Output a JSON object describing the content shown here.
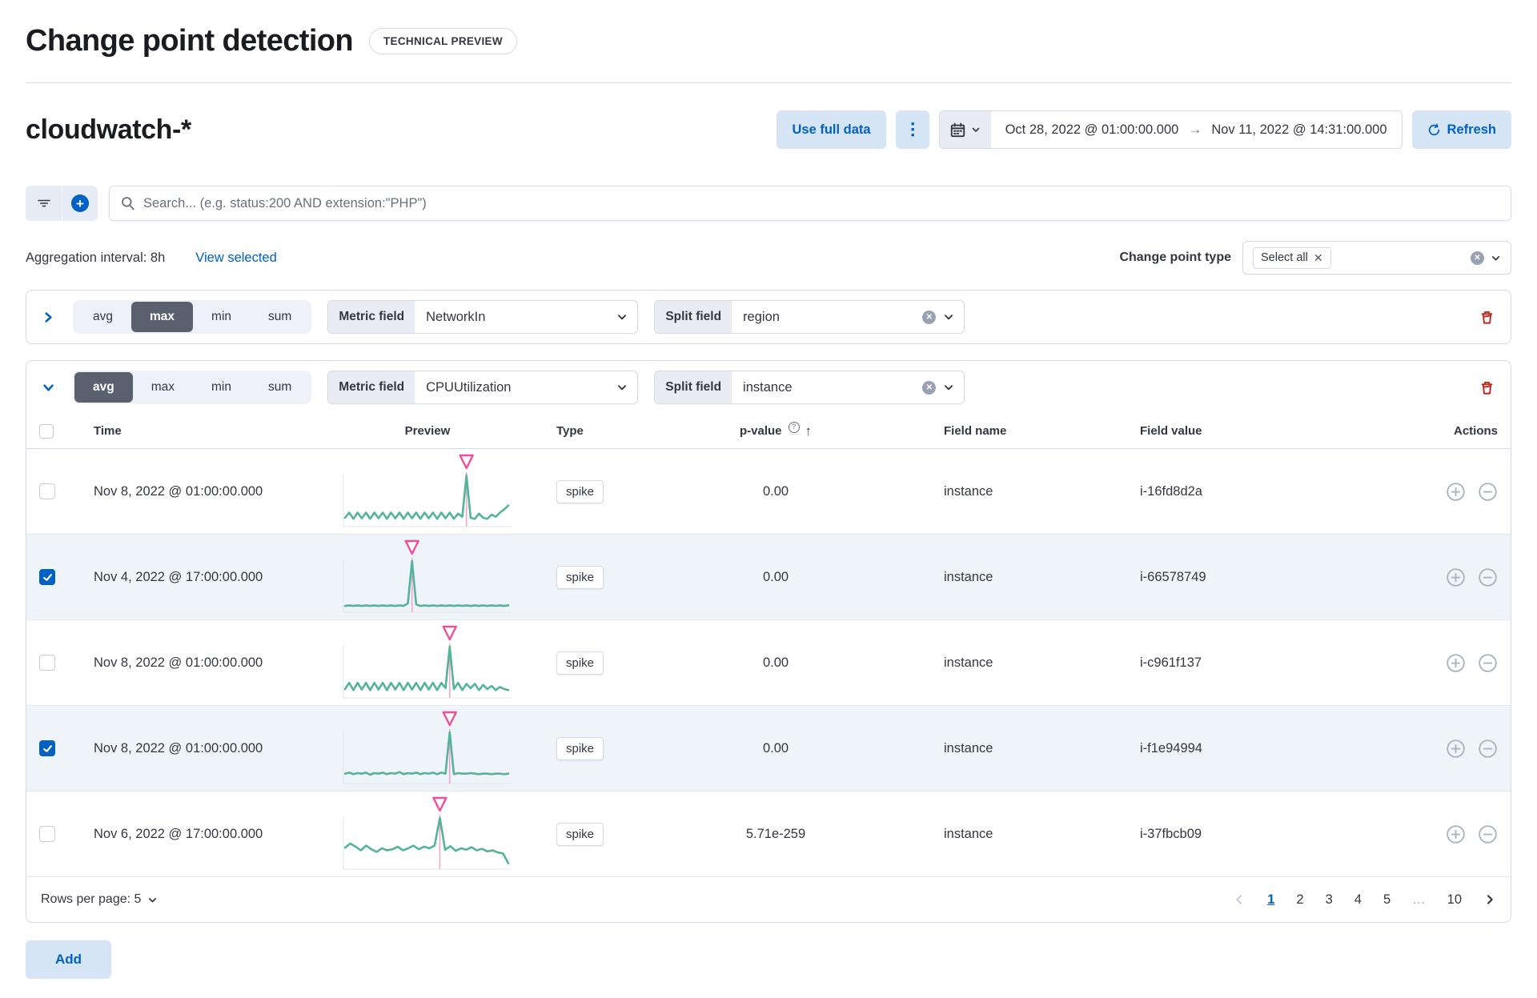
{
  "page": {
    "title": "Change point detection",
    "badge": "TECHNICAL PREVIEW"
  },
  "toolbar": {
    "index_pattern": "cloudwatch-*",
    "use_full_data": "Use full data",
    "date_start": "Oct 28, 2022 @ 01:00:00.000",
    "date_end": "Nov 11, 2022 @ 14:31:00.000",
    "date_arrow": "→",
    "refresh": "Refresh"
  },
  "search": {
    "placeholder": "Search... (e.g. status:200 AND extension:\"PHP\")"
  },
  "meta": {
    "aggregation_interval": "Aggregation interval: 8h",
    "view_selected": "View selected",
    "change_point_type_label": "Change point type",
    "change_point_type_value": "Select all",
    "pill_remove": "✕"
  },
  "configs": [
    {
      "agg_options": [
        "avg",
        "max",
        "min",
        "sum"
      ],
      "selected_agg": "max",
      "metric_label": "Metric field",
      "metric_value": "NetworkIn",
      "split_label": "Split field",
      "split_value": "region",
      "expanded": false
    },
    {
      "agg_options": [
        "avg",
        "max",
        "min",
        "sum"
      ],
      "selected_agg": "avg",
      "metric_label": "Metric field",
      "metric_value": "CPUUtilization",
      "split_label": "Split field",
      "split_value": "instance",
      "expanded": true
    }
  ],
  "table": {
    "columns": {
      "time": "Time",
      "preview": "Preview",
      "type": "Type",
      "p_value": "p-value",
      "field_name": "Field name",
      "field_value": "Field value",
      "actions": "Actions"
    },
    "p_value_info": "?",
    "sort_arrow": "↑",
    "rows": [
      {
        "checked": false,
        "time": "Nov 8, 2022 @ 01:00:00.000",
        "type": "spike",
        "p_value": "0.00",
        "field_name": "instance",
        "field_value": "i-16fd8d2a"
      },
      {
        "checked": true,
        "time": "Nov 4, 2022 @ 17:00:00.000",
        "type": "spike",
        "p_value": "0.00",
        "field_name": "instance",
        "field_value": "i-66578749"
      },
      {
        "checked": false,
        "time": "Nov 8, 2022 @ 01:00:00.000",
        "type": "spike",
        "p_value": "0.00",
        "field_name": "instance",
        "field_value": "i-c961f137"
      },
      {
        "checked": true,
        "time": "Nov 8, 2022 @ 01:00:00.000",
        "type": "spike",
        "p_value": "0.00",
        "field_name": "instance",
        "field_value": "i-f1e94994"
      },
      {
        "checked": false,
        "time": "Nov 6, 2022 @ 17:00:00.000",
        "type": "spike",
        "p_value": "5.71e-259",
        "field_name": "instance",
        "field_value": "i-37fbcb09"
      }
    ]
  },
  "chart_data": [
    {
      "type": "line",
      "label": "preview-spike-i-16fd8d2a",
      "color": "#54b399",
      "marker_color": "#f04e98",
      "spike_line_color": "#f2a7c3",
      "spike_index": 29,
      "values": [
        14,
        24,
        12,
        24,
        13,
        24,
        12,
        24,
        13,
        24,
        12,
        24,
        13,
        24,
        12,
        24,
        13,
        24,
        12,
        24,
        13,
        24,
        12,
        24,
        13,
        24,
        12,
        22,
        16,
        96,
        14,
        12,
        22,
        14,
        12,
        20,
        16,
        24,
        30,
        38
      ]
    },
    {
      "type": "line",
      "label": "preview-spike-i-66578749",
      "color": "#54b399",
      "marker_color": "#f04e98",
      "spike_line_color": "#f2a7c3",
      "spike_index": 16,
      "values": [
        9,
        10,
        9,
        10,
        9,
        10,
        9,
        10,
        9,
        10,
        9,
        10,
        9,
        10,
        9,
        14,
        94,
        12,
        9,
        10,
        9,
        10,
        9,
        10,
        9,
        10,
        9,
        10,
        9,
        10,
        9,
        10,
        9,
        10,
        9,
        10,
        9,
        10,
        9,
        10
      ]
    },
    {
      "type": "line",
      "label": "preview-spike-i-c961f137",
      "color": "#54b399",
      "marker_color": "#f04e98",
      "spike_line_color": "#f2a7c3",
      "spike_index": 25,
      "values": [
        14,
        26,
        12,
        26,
        13,
        26,
        12,
        26,
        13,
        26,
        12,
        26,
        13,
        26,
        12,
        26,
        13,
        26,
        12,
        26,
        13,
        26,
        12,
        26,
        16,
        96,
        14,
        26,
        12,
        24,
        16,
        24,
        12,
        22,
        14,
        20,
        12,
        18,
        14,
        12
      ]
    },
    {
      "type": "line",
      "label": "preview-spike-i-f1e94994",
      "color": "#54b399",
      "marker_color": "#f04e98",
      "spike_line_color": "#f2a7c3",
      "spike_index": 25,
      "values": [
        16,
        18,
        15,
        17,
        16,
        18,
        14,
        17,
        16,
        18,
        15,
        17,
        16,
        19,
        15,
        17,
        16,
        18,
        15,
        17,
        16,
        18,
        15,
        18,
        16,
        96,
        15,
        17,
        16,
        16,
        17,
        16,
        15,
        16,
        16,
        15,
        16,
        16,
        15,
        16
      ]
    },
    {
      "type": "line",
      "label": "preview-spike-i-37fbcb09",
      "color": "#54b399",
      "marker_color": "#f04e98",
      "spike_line_color": "#f2a7c3",
      "spike_index": 18,
      "values": [
        38,
        46,
        40,
        33,
        42,
        35,
        30,
        37,
        33,
        35,
        40,
        33,
        37,
        42,
        35,
        40,
        37,
        42,
        95,
        34,
        41,
        32,
        37,
        34,
        39,
        33,
        36,
        31,
        33,
        29,
        27,
        8
      ]
    }
  ],
  "pagination": {
    "rows_per_page": "Rows per page: 5",
    "pages": [
      "1",
      "2",
      "3",
      "4",
      "5",
      "…",
      "10"
    ],
    "current": "1"
  },
  "actions": {
    "add": "Add"
  },
  "colors": {
    "primary": "#0061c5",
    "light_button_bg": "#d6e5f6",
    "border": "#d3dae6",
    "selected_row_bg": "#eff4f9",
    "spark_green": "#54b399",
    "spike_pink": "#f04e98",
    "danger_red": "#bd271e"
  }
}
